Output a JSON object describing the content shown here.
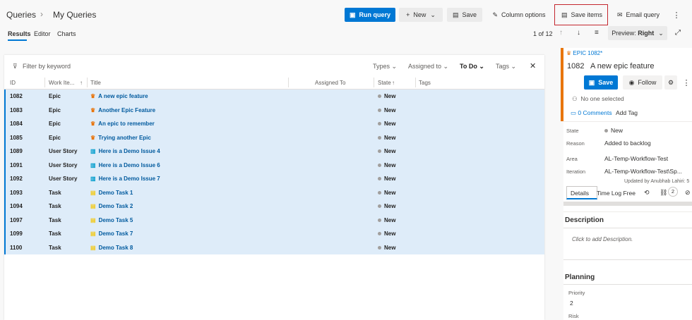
{
  "breadcrumb": {
    "root": "Queries",
    "sep": "›",
    "current": "My Queries"
  },
  "toolbar": {
    "run_query": "Run query",
    "new": "New",
    "save": "Save",
    "column_options": "Column options",
    "save_items": "Save items",
    "email_query": "Email query",
    "more": "⋮"
  },
  "tabs": [
    "Results",
    "Editor",
    "Charts"
  ],
  "pager": {
    "text": "1 of 12",
    "preview": "Preview:",
    "preview_value": "Right"
  },
  "filter": {
    "placeholder": "Filter by keyword",
    "types": "Types",
    "assigned_to": "Assigned to",
    "todo": "To Do",
    "tags": "Tags"
  },
  "columns": {
    "id": "ID",
    "type": "Work Ite...",
    "sort": "↑",
    "title": "Title",
    "assigned": "Assigned To",
    "state": "State",
    "state_sort": "↑",
    "tags": "Tags"
  },
  "rows": [
    {
      "id": "1082",
      "type": "Epic",
      "title": "A new epic feature",
      "state": "New"
    },
    {
      "id": "1083",
      "type": "Epic",
      "title": "Another Epic Feature",
      "state": "New"
    },
    {
      "id": "1084",
      "type": "Epic",
      "title": "An epic to remember",
      "state": "New"
    },
    {
      "id": "1085",
      "type": "Epic",
      "title": "Trying another Epic",
      "state": "New"
    },
    {
      "id": "1089",
      "type": "User Story",
      "title": "Here is a Demo Issue 4",
      "state": "New"
    },
    {
      "id": "1091",
      "type": "User Story",
      "title": "Here is a Demo Issue 6",
      "state": "New"
    },
    {
      "id": "1092",
      "type": "User Story",
      "title": "Here is a Demo Issue 7",
      "state": "New"
    },
    {
      "id": "1093",
      "type": "Task",
      "title": "Demo Task 1",
      "state": "New"
    },
    {
      "id": "1094",
      "type": "Task",
      "title": "Demo Task 2",
      "state": "New"
    },
    {
      "id": "1097",
      "type": "Task",
      "title": "Demo Task 5",
      "state": "New"
    },
    {
      "id": "1099",
      "type": "Task",
      "title": "Demo Task 7",
      "state": "New"
    },
    {
      "id": "1100",
      "type": "Task",
      "title": "Demo Task 8",
      "state": "New"
    }
  ],
  "preview": {
    "type_label": "EPIC 1082*",
    "id": "1082",
    "title": "A new epic feature",
    "save": "Save",
    "follow": "Follow",
    "no_one": "No one selected",
    "comments": "0 Comments",
    "add_tag": "Add Tag",
    "fields": {
      "state_l": "State",
      "state_v": "New",
      "reason_l": "Reason",
      "reason_v": "Added to backlog",
      "area_l": "Area",
      "area_v": "AL-Temp-Workflow-Test",
      "iter_l": "Iteration",
      "iter_v": "AL-Temp-Workflow-Test\\Sp..."
    },
    "updated": "Updated by Anubhab Lahiri: 5",
    "tab_details": "Details",
    "tab_timelog": "Time Log Free",
    "links": "2",
    "desc_h": "Description",
    "desc_p": "Click to add Description.",
    "plan_h": "Planning",
    "priority_l": "Priority",
    "priority_v": "2",
    "risk_l": "Risk"
  }
}
